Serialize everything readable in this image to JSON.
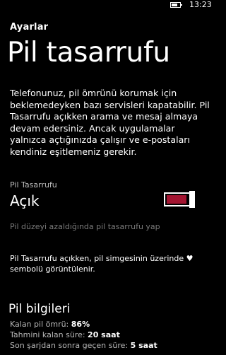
{
  "status": {
    "time": "13:23"
  },
  "header": {
    "app_title": "Ayarlar",
    "page_title": "Pil tasarrufu"
  },
  "description": "Telefonunuz, pil ömrünü korumak için beklemedeyken bazı servisleri kapatabilir. Pil Tasarrufu açıkken arama ve mesaj almaya devam edersiniz. Ancak uygulamalar yalnızca açtığınızda çalışır ve e-postaları kendiniz eşitlemeniz gerekir.",
  "toggle": {
    "label": "Pil Tasarrufu",
    "state": "Açık",
    "on": true,
    "accent": "#a31531"
  },
  "condition_link": "Pil düzeyi azaldığında pil tasarrufu yap",
  "note": {
    "text_before": "Pil Tasarrufu açıkken, pil simgesinin üzerinde",
    "heart": "♥",
    "text_after": "sembolü görüntülenir."
  },
  "battery_info": {
    "title": "Pil bilgileri",
    "rows": [
      {
        "label": "Kalan pil ömrü:",
        "value": "86%"
      },
      {
        "label": "Tahmini kalan süre:",
        "value": "20 saat"
      },
      {
        "label": "Son şarjdan sonra geçen süre:",
        "value": "5 saat"
      }
    ]
  }
}
